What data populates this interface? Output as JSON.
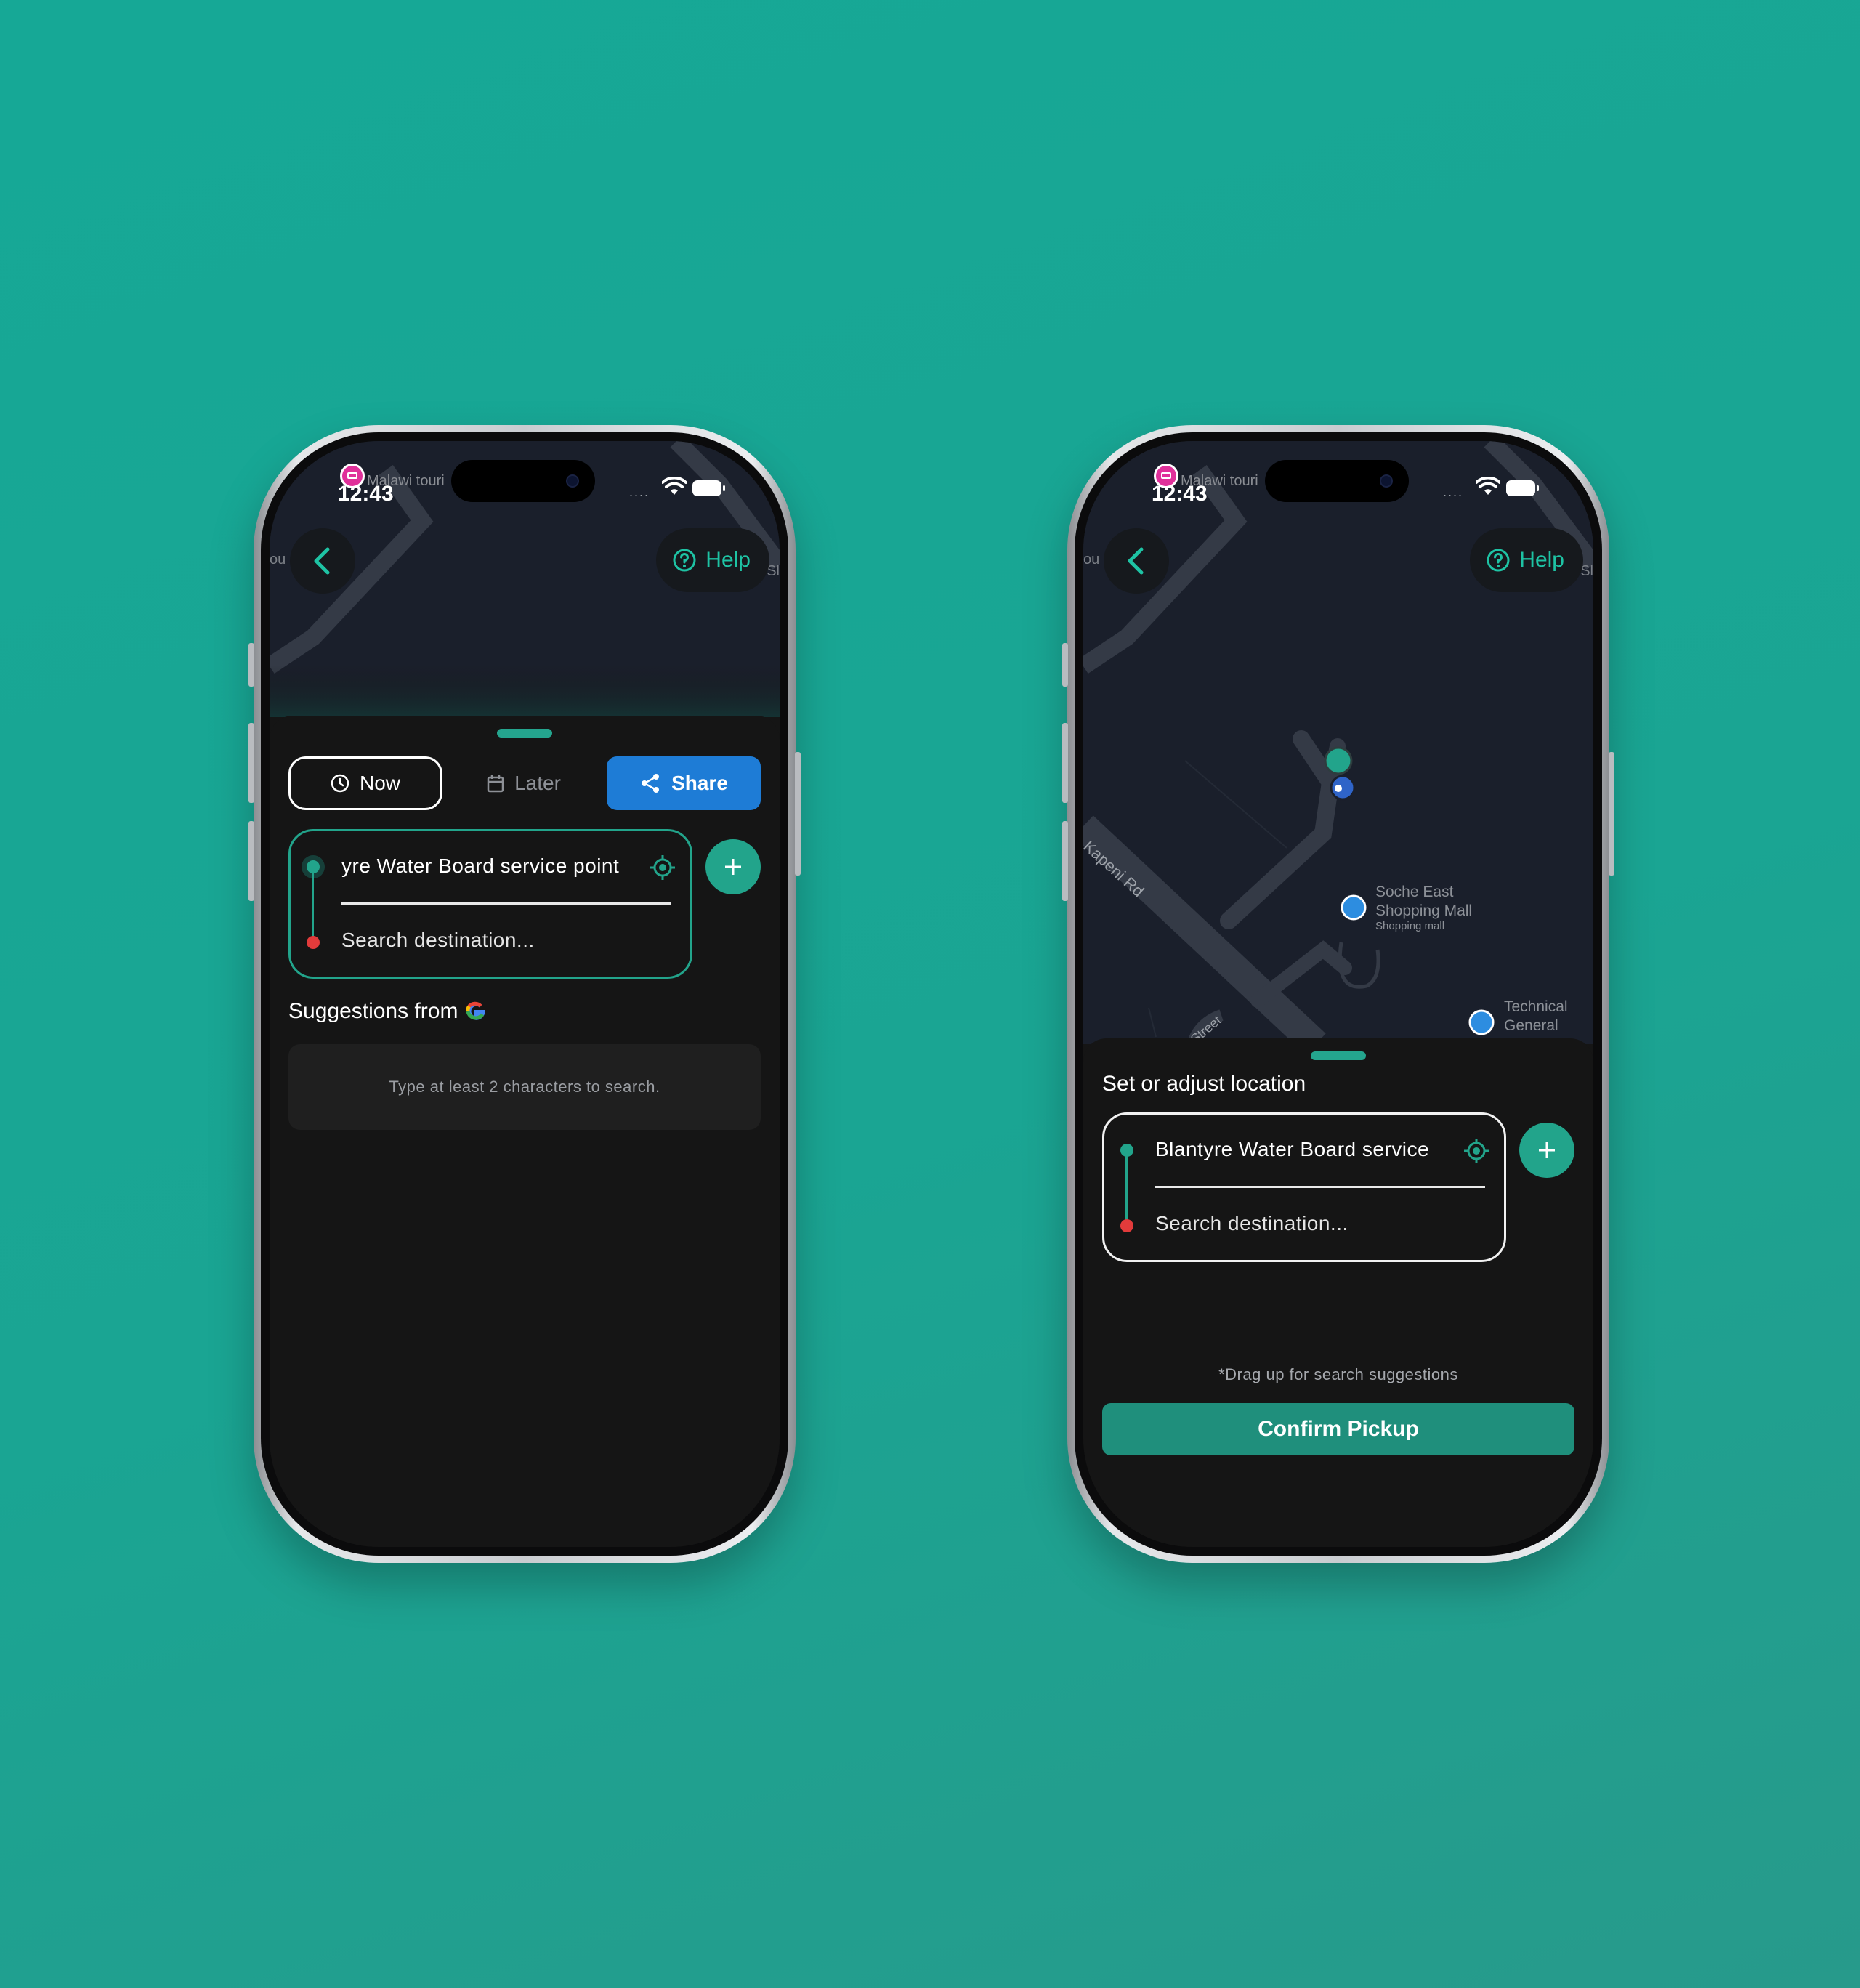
{
  "colors": {
    "background": "#16a896",
    "accent": "#22a48b",
    "share_blue": "#1e7cd6",
    "destination_red": "#e23b3b",
    "map_bg": "#1a1f2b",
    "sheet_bg": "#151515"
  },
  "status_bar": {
    "time": "12:43",
    "poi_label": "Malawi touri",
    "signal_dots": "....",
    "icons": [
      "poi-hotel-icon",
      "wifi-icon",
      "battery-icon"
    ]
  },
  "map": {
    "left_edge_label": "ou",
    "right_edge_label": "Sl",
    "help_label": "Help",
    "road_label": "Kapeni Rd",
    "street_label": "Street",
    "poi_1": {
      "name_line1": "Soche East",
      "name_line2": "Shopping Mall",
      "category": "Shopping mall"
    },
    "poi_2": {
      "name_line1": "Technical",
      "name_line2": "General Deal"
    }
  },
  "left_screen": {
    "segments": {
      "now": "Now",
      "later": "Later",
      "share": "Share"
    },
    "pickup_value": "yre Water Board service point",
    "destination_placeholder": "Search destination...",
    "suggestions_title": "Suggestions from",
    "empty_state": "Type at least 2 characters to search."
  },
  "right_screen": {
    "sheet_title": "Set or adjust location",
    "pickup_value": "Blantyre Water Board service",
    "destination_placeholder": "Search destination...",
    "drag_hint": "*Drag up for search suggestions",
    "confirm_label": "Confirm Pickup"
  }
}
